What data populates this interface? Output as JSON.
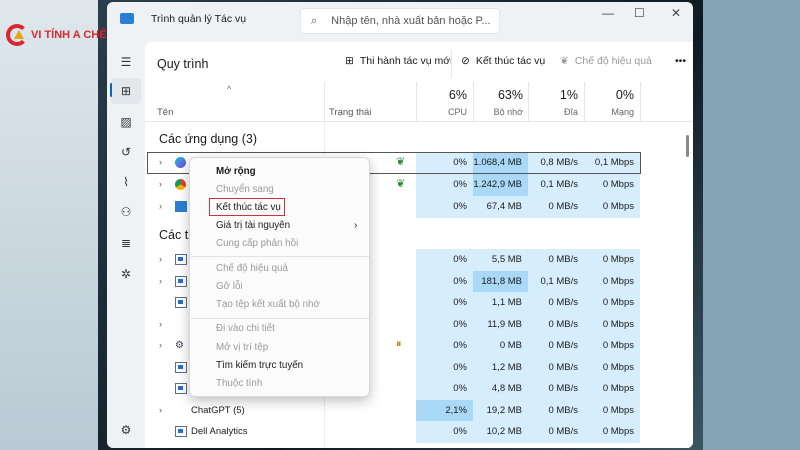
{
  "logo": {
    "text": "VI TÍNH A CHẾ"
  },
  "window": {
    "title": "Trình quản lý Tác vụ",
    "search_placeholder": "Nhập tên, nhà xuất bản hoặc P...",
    "minimize": "—",
    "maximize": "☐",
    "close": "✕"
  },
  "toolbar": {
    "page_title": "Quy trình",
    "run_new_task": "Thi hành tác vụ mới",
    "end_task": "Kết thúc tác vụ",
    "efficiency_mode": "Chế độ hiệu quả",
    "more": "•••"
  },
  "columns": {
    "name": "Tên",
    "status": "Trạng thái",
    "cpu_pct": "6%",
    "cpu": "CPU",
    "mem_pct": "63%",
    "mem": "Bộ nhớ",
    "disk_pct": "1%",
    "disk": "Đĩa",
    "net_pct": "0%",
    "net": "Mạng"
  },
  "groups": {
    "apps": "Các ứng dụng (3)",
    "background": "Các ti"
  },
  "apps": [
    {
      "icon": "canva-icon",
      "status": "eco-leaf",
      "cpu": "0%",
      "mem": "1.068,4 MB",
      "disk": "0,8 MB/s",
      "net": "0,1 Mbps",
      "hi": [
        "mem"
      ],
      "expand": true,
      "name": ""
    },
    {
      "icon": "chrome-icon",
      "status": "eco-leaf",
      "cpu": "0%",
      "mem": "1.242,9 MB",
      "disk": "0,1 MB/s",
      "net": "0 Mbps",
      "hi": [
        "mem"
      ],
      "expand": true,
      "name": ""
    },
    {
      "icon": "taskmgr-icon",
      "status": "",
      "cpu": "0%",
      "mem": "67,4 MB",
      "disk": "0 MB/s",
      "net": "0 Mbps",
      "hi": [],
      "expand": true,
      "name": ""
    }
  ],
  "background": [
    {
      "icon": "app-icon",
      "status": "",
      "cpu": "0%",
      "mem": "5,5 MB",
      "disk": "0 MB/s",
      "net": "0 Mbps",
      "hi": [],
      "expand": true,
      "name": ""
    },
    {
      "icon": "app-icon",
      "status": "",
      "cpu": "0%",
      "mem": "181,8 MB",
      "disk": "0,1 MB/s",
      "net": "0 Mbps",
      "hi": [
        "mem"
      ],
      "expand": true,
      "name": ""
    },
    {
      "icon": "app-icon",
      "status": "",
      "cpu": "0%",
      "mem": "1,1 MB",
      "disk": "0 MB/s",
      "net": "0 Mbps",
      "hi": [],
      "expand": false,
      "name": ""
    },
    {
      "icon": "",
      "status": "",
      "cpu": "0%",
      "mem": "11,9 MB",
      "disk": "0 MB/s",
      "net": "0 Mbps",
      "hi": [],
      "expand": true,
      "name": ""
    },
    {
      "icon": "gear-icon",
      "status": "paused",
      "cpu": "0%",
      "mem": "0 MB",
      "disk": "0 MB/s",
      "net": "0 Mbps",
      "hi": [],
      "expand": true,
      "name": ""
    },
    {
      "icon": "app-icon",
      "status": "",
      "cpu": "0%",
      "mem": "1,2 MB",
      "disk": "0 MB/s",
      "net": "0 Mbps",
      "hi": [],
      "expand": false,
      "name": ""
    },
    {
      "icon": "app-icon",
      "status": "",
      "cpu": "0%",
      "mem": "4,8 MB",
      "disk": "0 MB/s",
      "net": "0 Mbps",
      "hi": [],
      "expand": false,
      "name": ""
    },
    {
      "icon": "",
      "status": "",
      "cpu": "2,1%",
      "mem": "19,2 MB",
      "disk": "0 MB/s",
      "net": "0 Mbps",
      "hi": [
        "cpu"
      ],
      "expand": true,
      "name": "ChatGPT (5)"
    },
    {
      "icon": "app-icon",
      "status": "",
      "cpu": "0%",
      "mem": "10,2 MB",
      "disk": "0 MB/s",
      "net": "0 Mbps",
      "hi": [],
      "expand": false,
      "name": "Dell Analytics"
    }
  ],
  "context_menu": {
    "items": [
      {
        "label": "Mở rộng",
        "enabled": true,
        "bold": true
      },
      {
        "label": "Chuyển sang",
        "enabled": false
      },
      {
        "label": "Kết thúc tác vụ",
        "enabled": true,
        "highlighted": true
      },
      {
        "label": "Giá trị tài nguyên",
        "enabled": true,
        "submenu": true
      },
      {
        "label": "Cung cấp phản hồi",
        "enabled": false
      },
      {
        "label": "Chế độ hiệu quả",
        "enabled": false
      },
      {
        "label": "Gỡ lỗi",
        "enabled": false
      },
      {
        "label": "Tạo tệp kết xuất bộ nhớ",
        "enabled": false
      },
      {
        "label": "Đi vào chi tiết",
        "enabled": false
      },
      {
        "label": "Mở vị trí tệp",
        "enabled": false
      },
      {
        "label": "Tìm kiếm trực tuyến",
        "enabled": true
      },
      {
        "label": "Thuộc tính",
        "enabled": false
      }
    ]
  },
  "colors": {
    "usage_bg": "#d6eefc",
    "usage_high": "#a9d9f6",
    "highlight_box": "#d0303a",
    "accent": "#0a64c8"
  }
}
